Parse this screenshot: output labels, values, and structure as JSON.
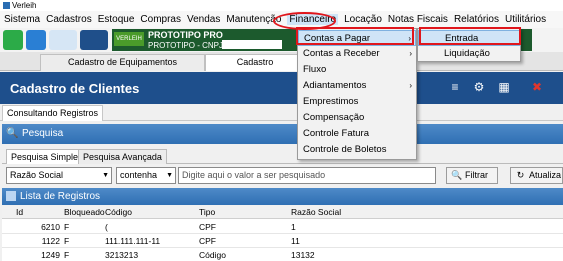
{
  "window": {
    "title": "Verleih"
  },
  "menubar": {
    "items": [
      "Sistema",
      "Cadastros",
      "Estoque",
      "Compras",
      "Vendas",
      "Manutenção",
      "Financeiro",
      "Locação",
      "Notas Fiscais",
      "Relatórios",
      "Utilitários"
    ],
    "active": "Financeiro"
  },
  "banner": {
    "logo_text": "VERLEIH",
    "title": "PROTOTIPO PRO",
    "subtitle": "PROTOTIPO - CNPJ :"
  },
  "tabs": [
    "Cadastro de Equipamentos",
    "Cadastro"
  ],
  "header": {
    "title": "Cadastro de Clientes"
  },
  "subtab": "Consultando Registros",
  "pesquisa": {
    "title": "Pesquisa",
    "tabs": [
      "Pesquisa Simples",
      "Pesquisa Avançada"
    ],
    "field_value": "Razão Social",
    "operator_value": "contenha",
    "search_placeholder": "Digite aqui o valor a ser pesquisado",
    "filter_button": "Filtrar",
    "refresh_button": "Atualiza"
  },
  "lista": {
    "title": "Lista de Registros",
    "columns": [
      "Id",
      "Bloqueado",
      "Código",
      "Tipo",
      "Razão Social"
    ],
    "rows": [
      {
        "id": "6210",
        "bloqueado": "F",
        "codigo": "(",
        "tipo": "CPF",
        "razao": "1"
      },
      {
        "id": "1122",
        "bloqueado": "F",
        "codigo": "111.111.111-11",
        "tipo": "CPF",
        "razao": "11"
      },
      {
        "id": "1249",
        "bloqueado": "F",
        "codigo": "3213213",
        "tipo": "Código",
        "razao": "13132"
      }
    ]
  },
  "financeiro_menu": {
    "items": [
      {
        "label": "Contas a Pagar",
        "has_sub": true,
        "selected": true
      },
      {
        "label": "Contas a Receber",
        "has_sub": true,
        "selected": false
      },
      {
        "label": "Fluxo",
        "has_sub": false,
        "selected": false
      },
      {
        "label": "Adiantamentos",
        "has_sub": true,
        "selected": false
      },
      {
        "label": "Emprestimos",
        "has_sub": false,
        "selected": false
      },
      {
        "label": "Compensação",
        "has_sub": false,
        "selected": false
      },
      {
        "label": "Controle Fatura",
        "has_sub": false,
        "selected": false
      },
      {
        "label": "Controle de Boletos",
        "has_sub": false,
        "selected": false
      }
    ]
  },
  "contas_pagar_submenu": {
    "items": [
      {
        "label": "Entrada",
        "selected": true
      },
      {
        "label": "Liquidação",
        "selected": false
      }
    ]
  },
  "colors": {
    "header_blue": "#1e4f8c",
    "panel_blue": "#2f6fb3",
    "highlight": "#cfe4f7",
    "annotation_red": "#e0161c",
    "banner_green": "#1c5a2d"
  }
}
